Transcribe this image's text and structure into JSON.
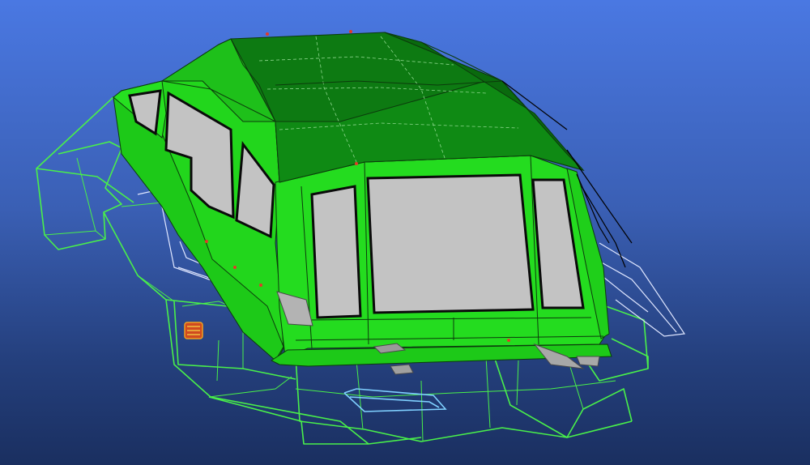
{
  "viewport": {
    "background_top": "#4a78e2",
    "background_bottom": "#1a2f60",
    "cab_shell_color": "#22d61c",
    "cab_roof_color": "#0d7a12",
    "wireframe_color": "#49f04a",
    "glass_color": "#c3c3c3",
    "marker_color": "#e23a2a"
  }
}
